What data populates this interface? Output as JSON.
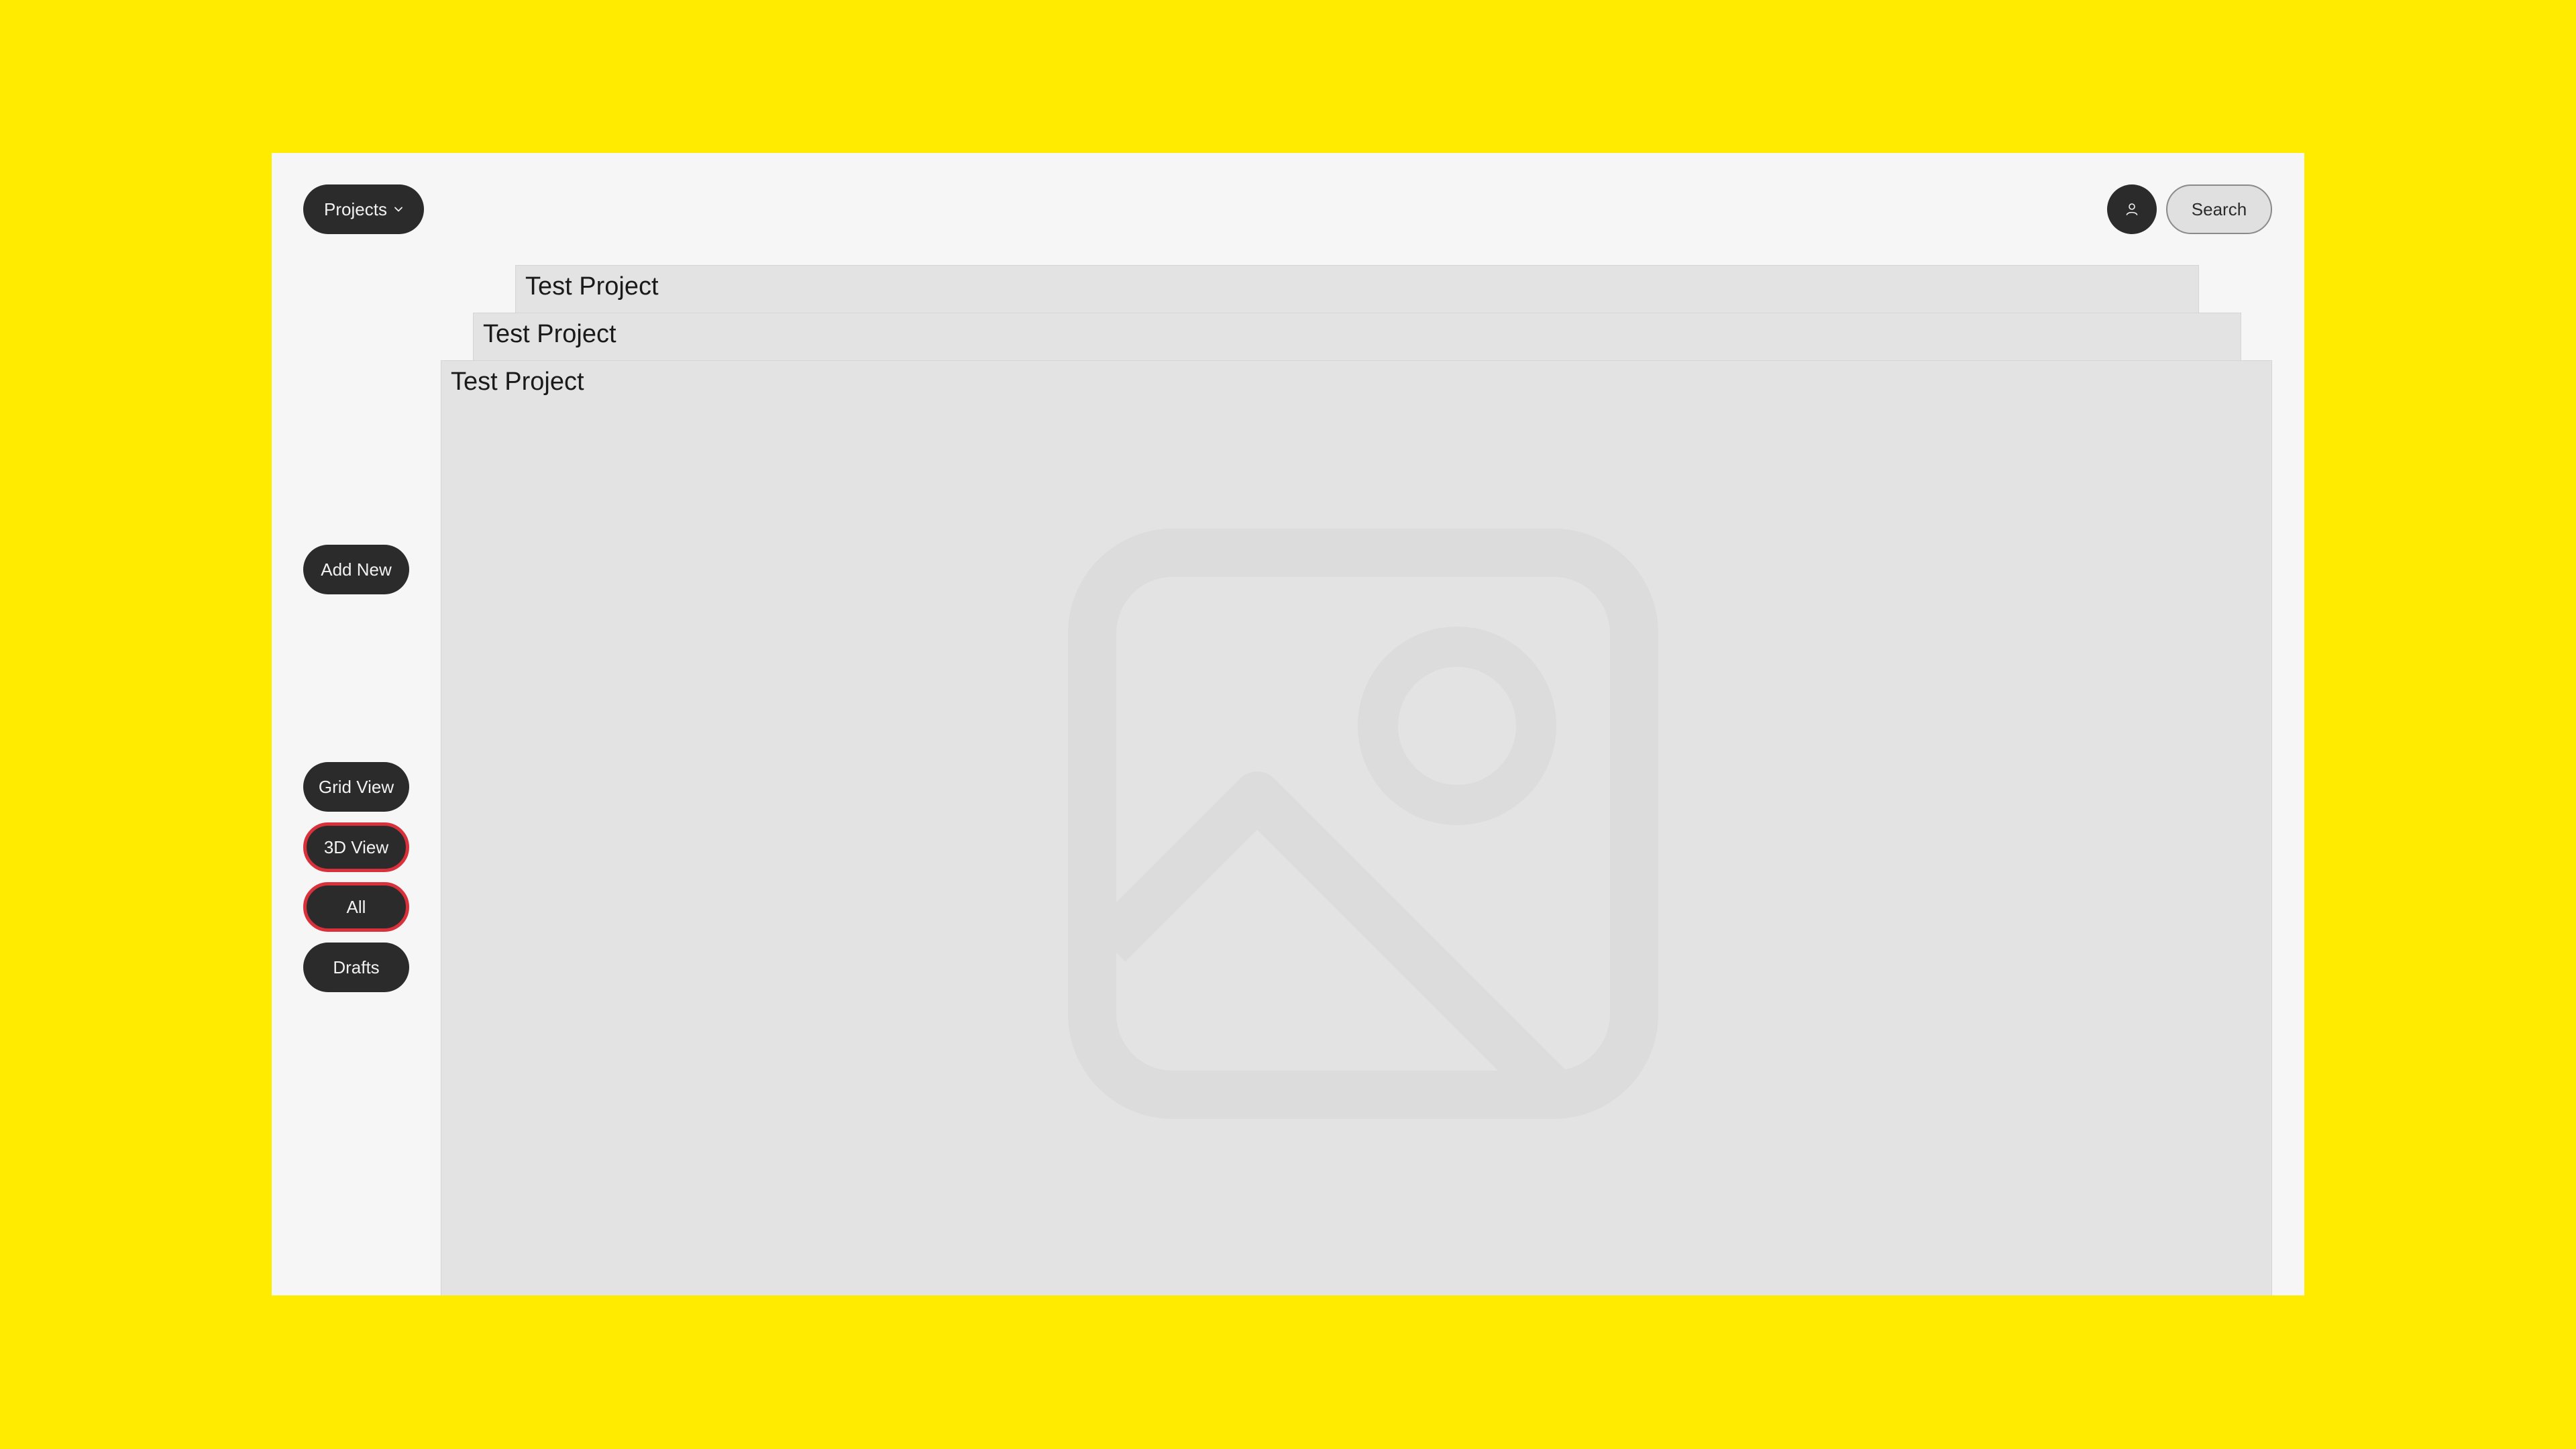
{
  "header": {
    "projects_label": "Projects",
    "search_label": "Search"
  },
  "sidebar": {
    "add_new_label": "Add New",
    "view_buttons": [
      {
        "label": "Grid View",
        "active": false
      },
      {
        "label": "3D View",
        "active": true
      },
      {
        "label": "All",
        "active": true
      },
      {
        "label": "Drafts",
        "active": false
      }
    ]
  },
  "cards": [
    {
      "title": "Test Project"
    },
    {
      "title": "Test Project"
    },
    {
      "title": "Test Project"
    }
  ],
  "colors": {
    "background": "#FFEB00",
    "panel": "#F6F6F6",
    "button": "#2B2B2B",
    "active_outline": "#D9313B",
    "card": "#E3E3E3"
  },
  "icons": {
    "projects_dropdown": "chevron-down-icon",
    "avatar": "user-icon",
    "card_placeholder": "image-placeholder-icon"
  }
}
